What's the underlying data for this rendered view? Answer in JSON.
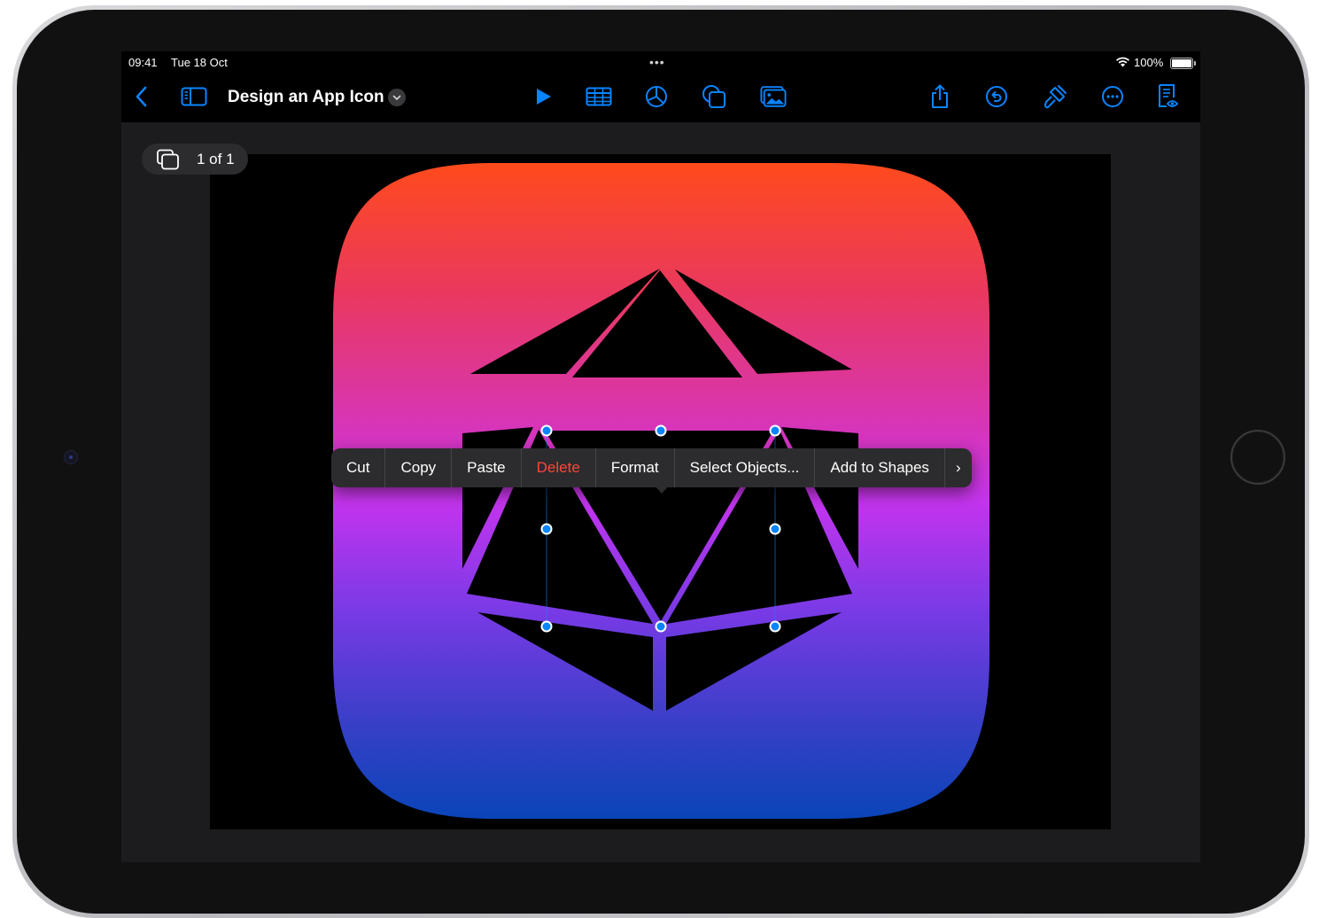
{
  "status_bar": {
    "time": "09:41",
    "date": "Tue 18 Oct",
    "multitask_indicator": "•••",
    "battery_percent": "100%"
  },
  "toolbar": {
    "document_title": "Design an App Icon",
    "icons": [
      "back-chevron-icon",
      "sidebar-icon",
      "title-menu-chevron-icon",
      "play-icon",
      "table-icon",
      "chart-icon",
      "shapes-icon",
      "media-icon",
      "share-icon",
      "undo-icon",
      "format-brush-icon",
      "more-icon",
      "reading-view-icon"
    ]
  },
  "page_indicator": {
    "label": "1 of 1"
  },
  "edit_menu": {
    "items": [
      "Cut",
      "Copy",
      "Paste",
      "Delete",
      "Format",
      "Select Objects...",
      "Add to Shapes"
    ],
    "more_glyph": "›"
  },
  "colors": {
    "accent": "#0a84ff",
    "destructive": "#ff453a",
    "gradient_top": "#ff4a1c",
    "gradient_mid": "#c334e8",
    "gradient_bottom": "#0a44b8"
  }
}
